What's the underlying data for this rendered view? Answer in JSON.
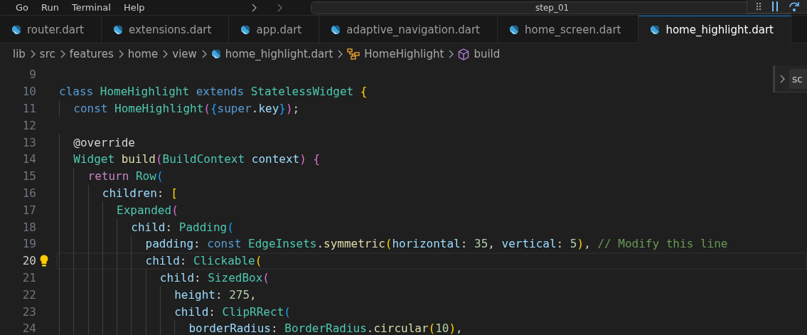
{
  "menu": [
    "Go",
    "Run",
    "Terminal",
    "Help"
  ],
  "command_center": {
    "title": "step_01"
  },
  "tabs": [
    {
      "label": "router.dart",
      "selected": false
    },
    {
      "label": "extensions.dart",
      "selected": false
    },
    {
      "label": "app.dart",
      "selected": false
    },
    {
      "label": "adaptive_navigation.dart",
      "selected": false
    },
    {
      "label": "home_screen.dart",
      "selected": false
    },
    {
      "label": "home_highlight.dart",
      "selected": true
    }
  ],
  "breadcrumb": [
    {
      "kind": "folder",
      "label": "lib"
    },
    {
      "kind": "folder",
      "label": "src"
    },
    {
      "kind": "folder",
      "label": "features"
    },
    {
      "kind": "folder",
      "label": "home"
    },
    {
      "kind": "folder",
      "label": "view"
    },
    {
      "kind": "file",
      "label": "home_highlight.dart"
    },
    {
      "kind": "class",
      "label": "HomeHighlight"
    },
    {
      "kind": "method",
      "label": "build"
    }
  ],
  "find_widget": {
    "value": "sc"
  },
  "lines": [
    {
      "number": "9",
      "current": false,
      "hint": false
    },
    {
      "number": "10",
      "current": false,
      "hint": false,
      "tokens": [
        {
          "kind": "keyword",
          "text": "class "
        },
        {
          "kind": "type",
          "text": "HomeHighlight "
        },
        {
          "kind": "keyword",
          "text": "extends "
        },
        {
          "kind": "type",
          "text": "StatelessWidget "
        },
        {
          "kind": "bracket1",
          "text": "{"
        }
      ]
    },
    {
      "number": "11",
      "current": false,
      "hint": false,
      "tokens": [
        {
          "kind": "keyword",
          "text": "  const "
        },
        {
          "kind": "type",
          "text": "HomeHighlight"
        },
        {
          "kind": "bracket2",
          "text": "("
        },
        {
          "kind": "bracket3",
          "text": "{"
        },
        {
          "kind": "keyword",
          "text": "super"
        },
        {
          "kind": "plain",
          "text": "."
        },
        {
          "kind": "variable",
          "text": "key"
        },
        {
          "kind": "bracket3",
          "text": "}"
        },
        {
          "kind": "bracket2",
          "text": ")"
        },
        {
          "kind": "plain",
          "text": ";"
        }
      ]
    },
    {
      "number": "12",
      "current": false,
      "hint": false
    },
    {
      "number": "13",
      "current": false,
      "hint": false,
      "tokens": [
        {
          "kind": "plain",
          "text": "  @override"
        }
      ]
    },
    {
      "number": "14",
      "current": false,
      "hint": false,
      "tokens": [
        {
          "kind": "type",
          "text": "  Widget "
        },
        {
          "kind": "function",
          "text": "build"
        },
        {
          "kind": "bracket2",
          "text": "("
        },
        {
          "kind": "type",
          "text": "BuildContext "
        },
        {
          "kind": "variable",
          "text": "context"
        },
        {
          "kind": "bracket2",
          "text": ")"
        },
        {
          "kind": "bracket2",
          "text": " {"
        }
      ]
    },
    {
      "number": "15",
      "current": false,
      "hint": false,
      "tokens": [
        {
          "kind": "control",
          "text": "    return "
        },
        {
          "kind": "type",
          "text": "Row"
        },
        {
          "kind": "bracket3",
          "text": "("
        }
      ]
    },
    {
      "number": "16",
      "current": false,
      "hint": false,
      "tokens": [
        {
          "kind": "variable",
          "text": "      children"
        },
        {
          "kind": "plain",
          "text": ": "
        },
        {
          "kind": "bracket1",
          "text": "["
        }
      ]
    },
    {
      "number": "17",
      "current": false,
      "hint": false,
      "tokens": [
        {
          "kind": "type",
          "text": "        Expanded"
        },
        {
          "kind": "bracket2",
          "text": "("
        }
      ]
    },
    {
      "number": "18",
      "current": false,
      "hint": false,
      "tokens": [
        {
          "kind": "variable",
          "text": "          child"
        },
        {
          "kind": "plain",
          "text": ": "
        },
        {
          "kind": "type",
          "text": "Padding"
        },
        {
          "kind": "bracket3",
          "text": "("
        }
      ]
    },
    {
      "number": "19",
      "current": false,
      "hint": false,
      "tokens": [
        {
          "kind": "variable",
          "text": "            padding"
        },
        {
          "kind": "plain",
          "text": ": "
        },
        {
          "kind": "keyword",
          "text": "const "
        },
        {
          "kind": "type",
          "text": "EdgeInsets"
        },
        {
          "kind": "plain",
          "text": "."
        },
        {
          "kind": "function",
          "text": "symmetric"
        },
        {
          "kind": "bracket1",
          "text": "("
        },
        {
          "kind": "variable",
          "text": "horizontal"
        },
        {
          "kind": "plain",
          "text": ": "
        },
        {
          "kind": "number",
          "text": "35"
        },
        {
          "kind": "plain",
          "text": ", "
        },
        {
          "kind": "variable",
          "text": "vertical"
        },
        {
          "kind": "plain",
          "text": ": "
        },
        {
          "kind": "number",
          "text": "5"
        },
        {
          "kind": "bracket1",
          "text": ")"
        },
        {
          "kind": "plain",
          "text": ", "
        },
        {
          "kind": "comment",
          "text": "// Modify this line"
        }
      ]
    },
    {
      "number": "20",
      "current": true,
      "hint": true,
      "tokens": [
        {
          "kind": "variable",
          "text": "            child"
        },
        {
          "kind": "plain",
          "text": ": "
        },
        {
          "kind": "type",
          "text": "Clickable"
        },
        {
          "kind": "bracket1",
          "text": "("
        }
      ]
    },
    {
      "number": "21",
      "current": false,
      "hint": false,
      "tokens": [
        {
          "kind": "variable",
          "text": "              child"
        },
        {
          "kind": "plain",
          "text": ": "
        },
        {
          "kind": "type",
          "text": "SizedBox"
        },
        {
          "kind": "bracket2",
          "text": "("
        }
      ]
    },
    {
      "number": "22",
      "current": false,
      "hint": false,
      "tokens": [
        {
          "kind": "variable",
          "text": "                height"
        },
        {
          "kind": "plain",
          "text": ": "
        },
        {
          "kind": "number",
          "text": "275"
        },
        {
          "kind": "plain",
          "text": ","
        }
      ]
    },
    {
      "number": "23",
      "current": false,
      "hint": false,
      "tokens": [
        {
          "kind": "variable",
          "text": "                child"
        },
        {
          "kind": "plain",
          "text": ": "
        },
        {
          "kind": "type",
          "text": "ClipRRect"
        },
        {
          "kind": "bracket3",
          "text": "("
        }
      ]
    },
    {
      "number": "24",
      "current": false,
      "hint": false,
      "tokens": [
        {
          "kind": "variable",
          "text": "                  borderRadius"
        },
        {
          "kind": "plain",
          "text": ": "
        },
        {
          "kind": "type",
          "text": "BorderRadius"
        },
        {
          "kind": "plain",
          "text": "."
        },
        {
          "kind": "function",
          "text": "circular"
        },
        {
          "kind": "bracket1",
          "text": "("
        },
        {
          "kind": "number",
          "text": "10"
        },
        {
          "kind": "bracket1",
          "text": ")"
        },
        {
          "kind": "plain",
          "text": ","
        }
      ]
    }
  ]
}
